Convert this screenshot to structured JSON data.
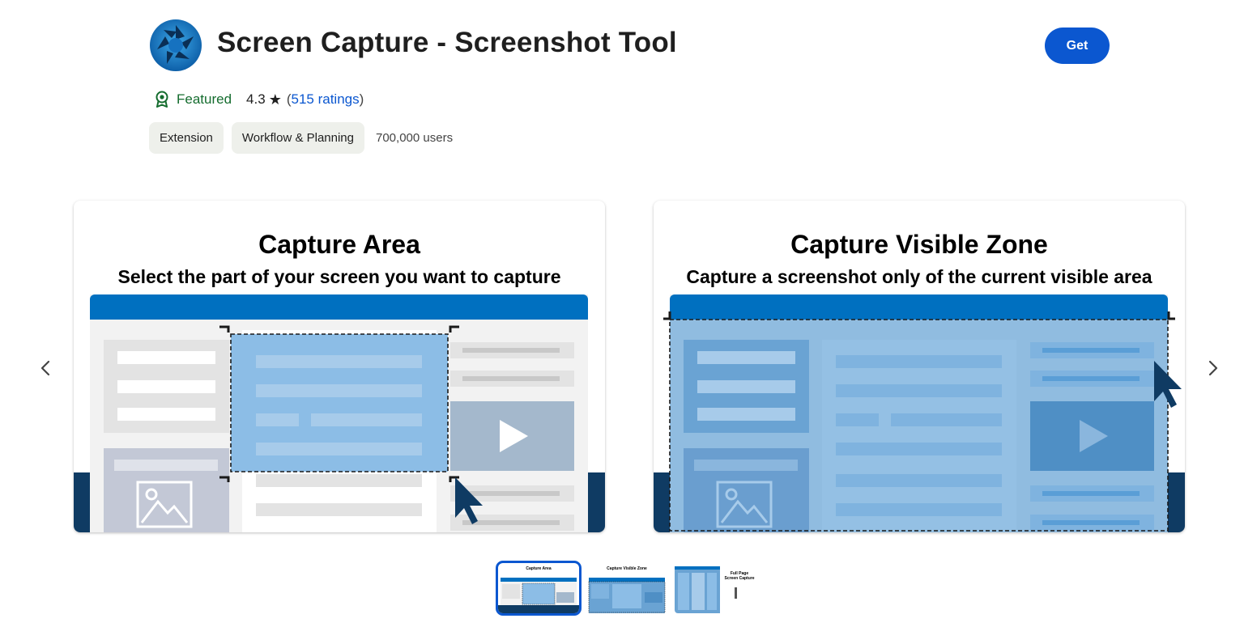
{
  "header": {
    "title": "Screen Capture - Screenshot Tool",
    "get_label": "Get"
  },
  "meta": {
    "featured_label": "Featured",
    "rating": "4.3",
    "ratings_text": "515 ratings",
    "paren_open": "(",
    "paren_close": ")"
  },
  "chips": [
    "Extension",
    "Workflow & Planning"
  ],
  "users": "700,000 users",
  "slides": [
    {
      "title": "Capture Area",
      "subtitle": "Select the part of your screen you want to capture"
    },
    {
      "title": "Capture Visible Zone",
      "subtitle": "Capture a screenshot only of the current visible area"
    }
  ],
  "thumbnails": [
    {
      "title": "Capture Area",
      "active": true
    },
    {
      "title": "Capture Visible Zone",
      "active": false
    },
    {
      "title": "Full Page Screen Capture",
      "active": false
    }
  ],
  "colors": {
    "primary_button": "#0b57d0",
    "featured": "#146c2e",
    "link": "#0b57d0",
    "slide_header_bar": "#0070c0",
    "slide_footer": "#0f3b63"
  },
  "icons": {
    "logo": "camera-aperture-icon",
    "featured": "award-badge-icon",
    "star": "star-icon",
    "prev": "chevron-left-icon",
    "next": "chevron-right-icon"
  }
}
